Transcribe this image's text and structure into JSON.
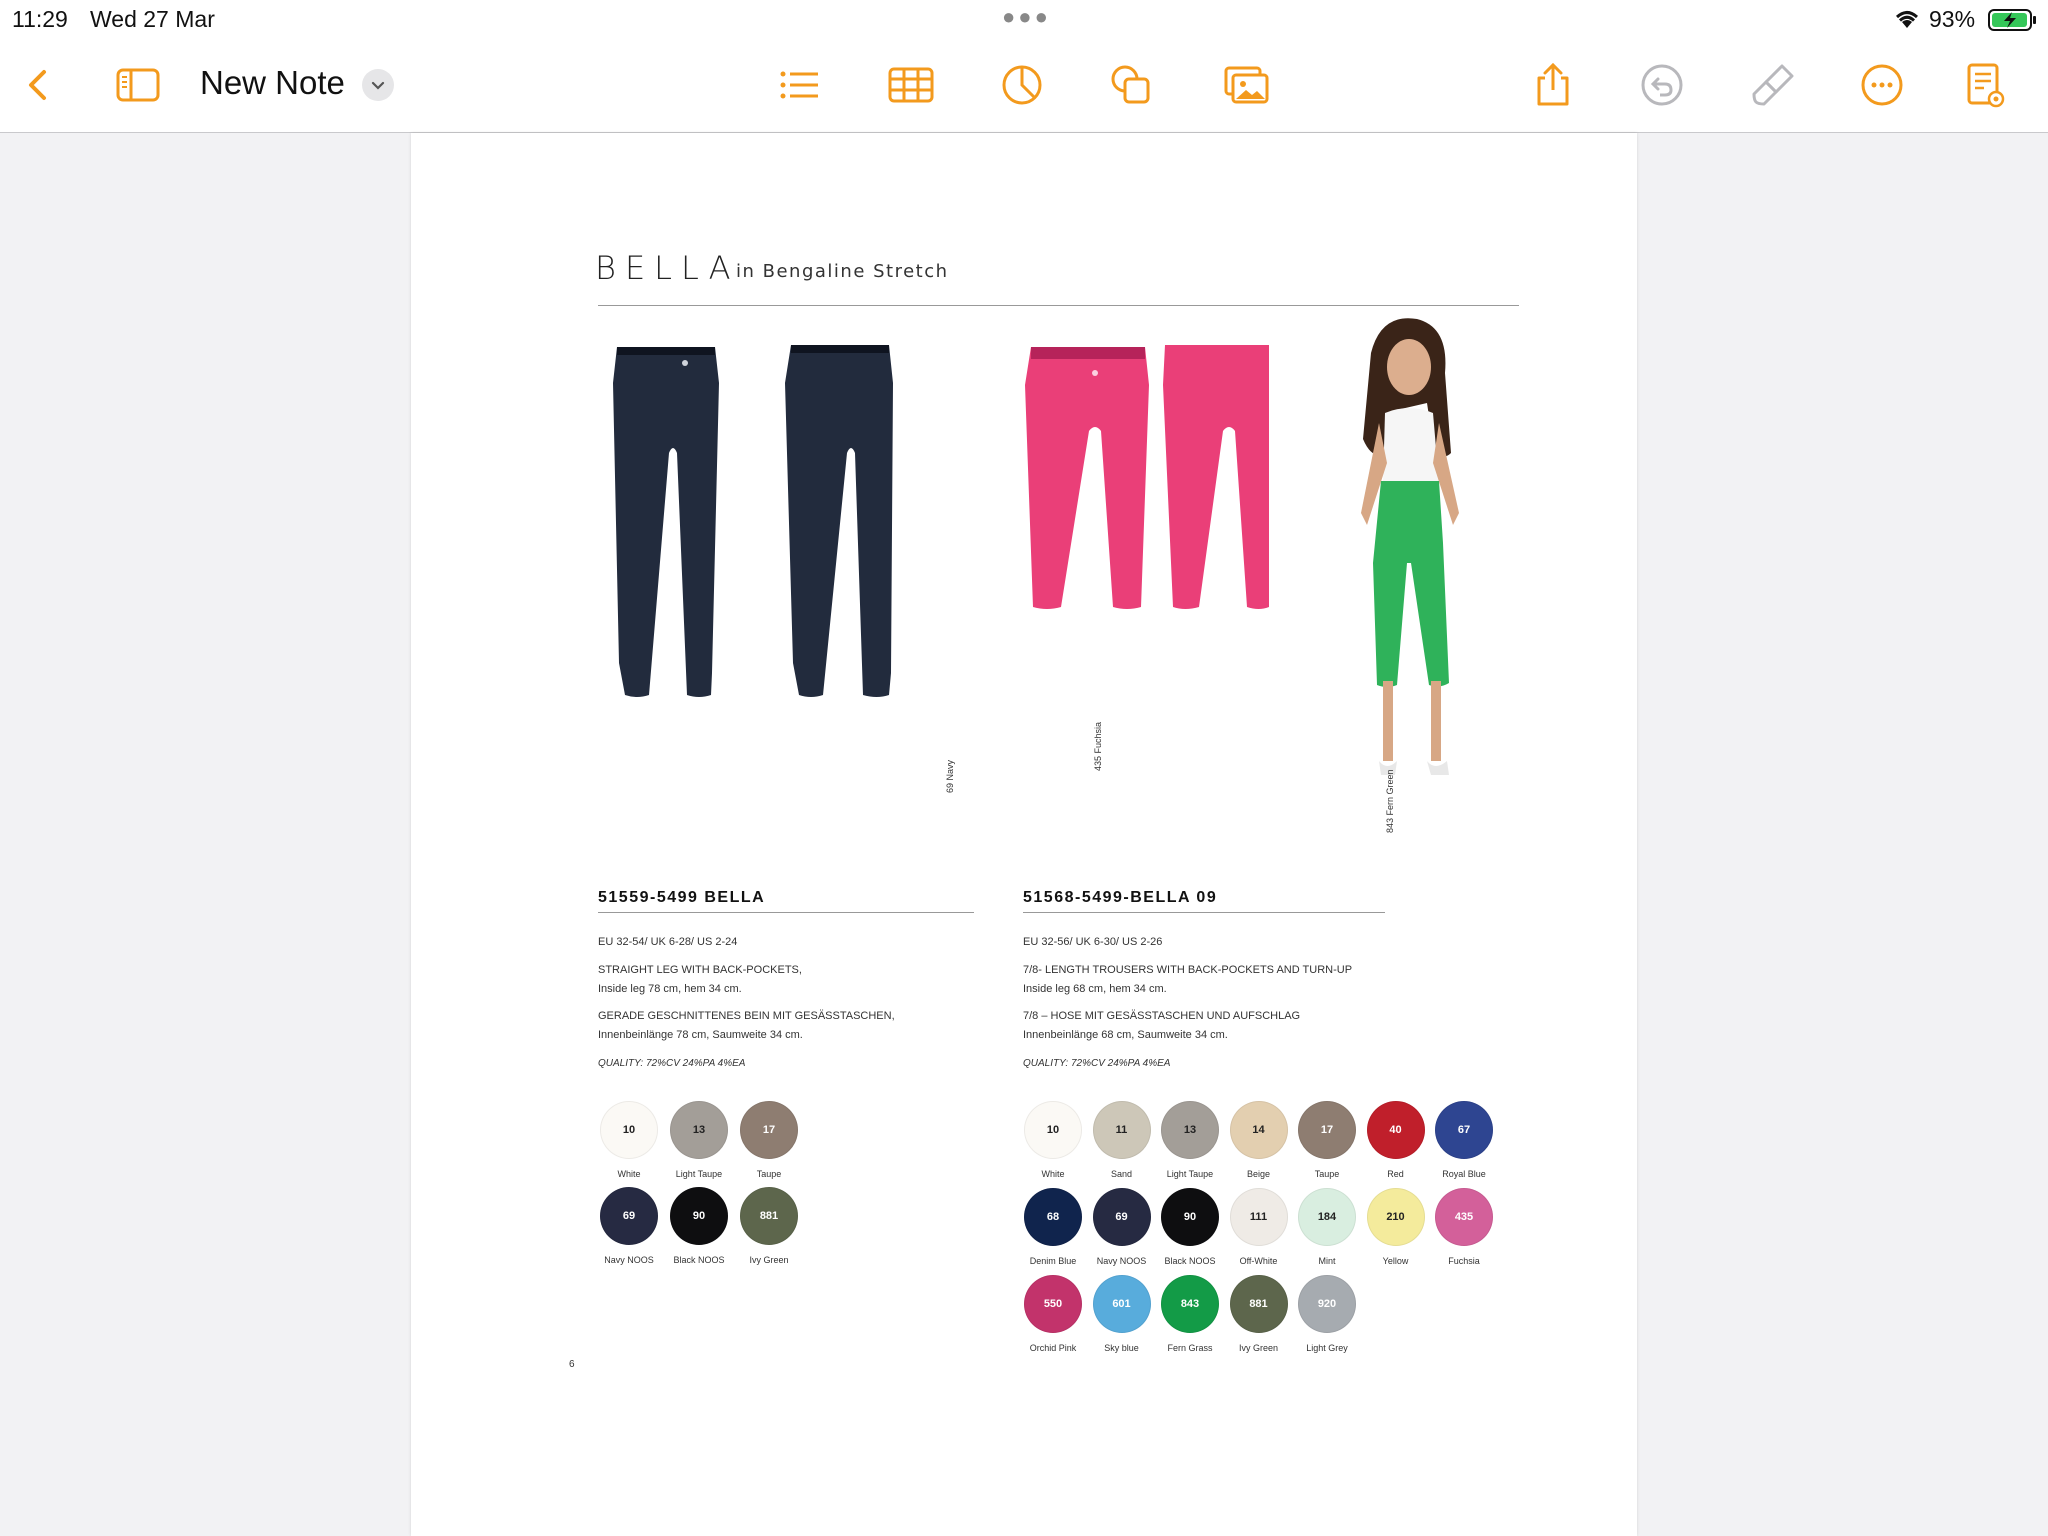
{
  "status": {
    "time": "11:29",
    "date": "Wed 27 Mar",
    "battery_pct": "93%"
  },
  "toolbar": {
    "title": "New Note"
  },
  "doc": {
    "brand": "BELLA",
    "brand_sub": "in Bengaline Stretch",
    "page_number": "6",
    "photo_labels": {
      "navy": "69 Navy",
      "fuchsia": "435 Fuchsia",
      "green": "843 Fern Green"
    },
    "product1": {
      "title": "51559-5499 BELLA",
      "sizes": "EU 32-54/ UK 6-28/ US 2-24",
      "desc_en_1": "STRAIGHT LEG WITH BACK-POCKETS,",
      "desc_en_2": "Inside leg 78 cm, hem 34 cm.",
      "desc_de_1": "GERADE GESCHNITTENES BEIN MIT GESÄSSTASCHEN,",
      "desc_de_2": "Innenbeinlänge 78 cm, Saumweite 34 cm.",
      "quality": "QUALITY: 72%CV 24%PA 4%EA",
      "swatches": [
        {
          "code": "10",
          "name": "White",
          "color": "#fbf9f5",
          "text": "#222"
        },
        {
          "code": "13",
          "name": "Light Taupe",
          "color": "#a39e98",
          "text": "#222"
        },
        {
          "code": "17",
          "name": "Taupe",
          "color": "#8e7d71",
          "text": "#fff"
        },
        {
          "code": "69",
          "name": "Navy NOOS",
          "color": "#262a42",
          "text": "#fff"
        },
        {
          "code": "90",
          "name": "Black NOOS",
          "color": "#0e0e10",
          "text": "#fff"
        },
        {
          "code": "881",
          "name": "Ivy Green",
          "color": "#5d664c",
          "text": "#fff"
        }
      ]
    },
    "product2": {
      "title": "51568-5499-BELLA 09",
      "sizes": "EU 32-56/ UK 6-30/ US 2-26",
      "desc_en_1": "7/8- LENGTH TROUSERS WITH BACK-POCKETS AND TURN-UP",
      "desc_en_2": "Inside leg 68 cm, hem 34 cm.",
      "desc_de_1": "7/8 – HOSE MIT GESÄSSTASCHEN UND AUFSCHLAG",
      "desc_de_2": "Innenbeinlänge 68 cm, Saumweite 34 cm.",
      "quality": "QUALITY: 72%CV 24%PA 4%EA",
      "swatches": [
        {
          "code": "10",
          "name": "White",
          "color": "#fbf9f5",
          "text": "#222"
        },
        {
          "code": "11",
          "name": "Sand",
          "color": "#cdc7b8",
          "text": "#222"
        },
        {
          "code": "13",
          "name": "Light Taupe",
          "color": "#a39e98",
          "text": "#222"
        },
        {
          "code": "14",
          "name": "Beige",
          "color": "#e3cfb0",
          "text": "#222"
        },
        {
          "code": "17",
          "name": "Taupe",
          "color": "#8e7d71",
          "text": "#fff"
        },
        {
          "code": "40",
          "name": "Red",
          "color": "#c01f2b",
          "text": "#fff"
        },
        {
          "code": "67",
          "name": "Royal Blue",
          "color": "#2e4591",
          "text": "#fff"
        },
        {
          "code": "68",
          "name": "Denim Blue",
          "color": "#10244d",
          "text": "#fff"
        },
        {
          "code": "69",
          "name": "Navy NOOS",
          "color": "#262a42",
          "text": "#fff"
        },
        {
          "code": "90",
          "name": "Black NOOS",
          "color": "#0e0e10",
          "text": "#fff"
        },
        {
          "code": "111",
          "name": "Off-White",
          "color": "#efebe6",
          "text": "#222"
        },
        {
          "code": "184",
          "name": "Mint",
          "color": "#d9eee0",
          "text": "#222"
        },
        {
          "code": "210",
          "name": "Yellow",
          "color": "#f4eb9c",
          "text": "#222"
        },
        {
          "code": "435",
          "name": "Fuchsia",
          "color": "#d3609a",
          "text": "#fff"
        },
        {
          "code": "550",
          "name": "Orchid Pink",
          "color": "#c2336b",
          "text": "#fff"
        },
        {
          "code": "601",
          "name": "Sky blue",
          "color": "#58acdc",
          "text": "#fff"
        },
        {
          "code": "843",
          "name": "Fern Grass",
          "color": "#139b47",
          "text": "#fff"
        },
        {
          "code": "881",
          "name": "Ivy Green",
          "color": "#5d664c",
          "text": "#fff"
        },
        {
          "code": "920",
          "name": "Light Grey",
          "color": "#a6abb0",
          "text": "#fff"
        }
      ]
    }
  },
  "colors": {
    "accent": "#f39a1d",
    "navy_trousers": "#222b3d",
    "fuchsia_trousers": "#ea3f78",
    "fern_trousers": "#2fb25a"
  }
}
